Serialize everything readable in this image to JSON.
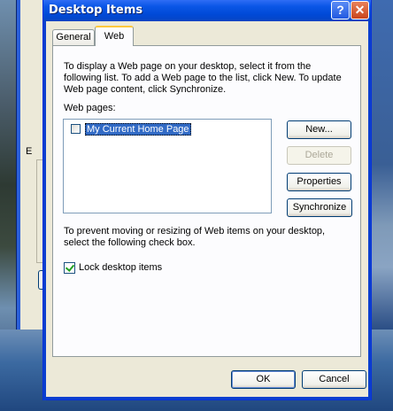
{
  "window": {
    "title": "Desktop Items",
    "help_button": "?",
    "close_button": "✕"
  },
  "background_window": {
    "fragment_label": "E"
  },
  "tabs": [
    {
      "label": "General",
      "selected": false
    },
    {
      "label": "Web",
      "selected": true
    }
  ],
  "web_tab": {
    "description": "To display a Web page on your desktop, select it from the following list. To add a Web page to the list, click New.  To update Web page content, click Synchronize.",
    "webpages_label": "Web pages:",
    "webpages": [
      {
        "label": "My Current Home Page",
        "checked": false,
        "selected": true
      }
    ],
    "buttons": {
      "new": "New...",
      "delete": "Delete",
      "properties": "Properties",
      "synchronize": "Synchronize"
    },
    "prevent_text": "To prevent moving or resizing of Web items on your desktop, select the following check box.",
    "lock_label": "Lock desktop items",
    "lock_checked": true
  },
  "footer": {
    "ok": "OK",
    "cancel": "Cancel"
  }
}
